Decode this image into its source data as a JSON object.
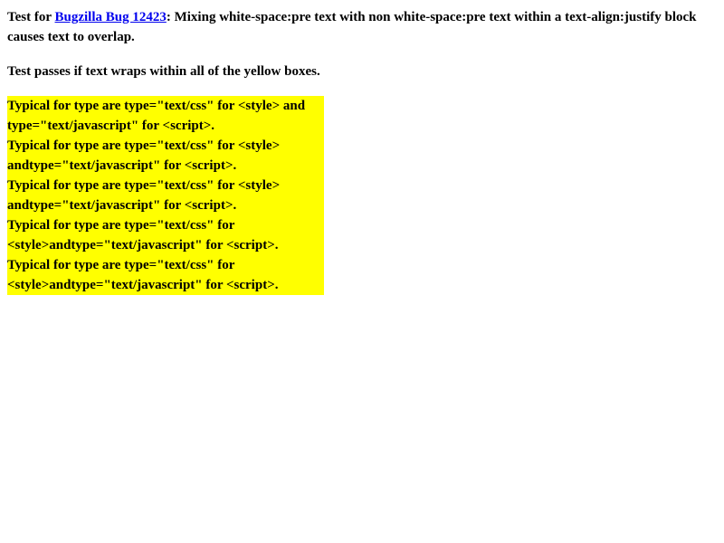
{
  "intro": {
    "prefix": "Test for ",
    "link_text": "Bugzilla Bug 12423",
    "suffix": ": Mixing white-space:pre text with non white-space:pre text within a text-align:justify block causes text to overlap."
  },
  "instruction": "Test passes if text wraps within all of the yellow boxes.",
  "yellow_box": {
    "color": "#ffff00",
    "lines": [
      "Typical for type are type=\"text/css\" for <style> and",
      "type=\"text/javascript\" for <script>.",
      "Typical for type are type=\"text/css\" for <style>",
      "andtype=\"text/javascript\" for <script>.",
      "Typical for type are type=\"text/css\" for <style>",
      "andtype=\"text/javascript\" for <script>.",
      "Typical for type are type=\"text/css\" for",
      "<style>andtype=\"text/javascript\" for <script>.",
      "Typical for type are type=\"text/css\" for",
      "<style>andtype=\"text/javascript\" for <script>."
    ]
  },
  "colors": {
    "link": "#0000ee",
    "text": "#000000",
    "background": "#ffffff"
  }
}
